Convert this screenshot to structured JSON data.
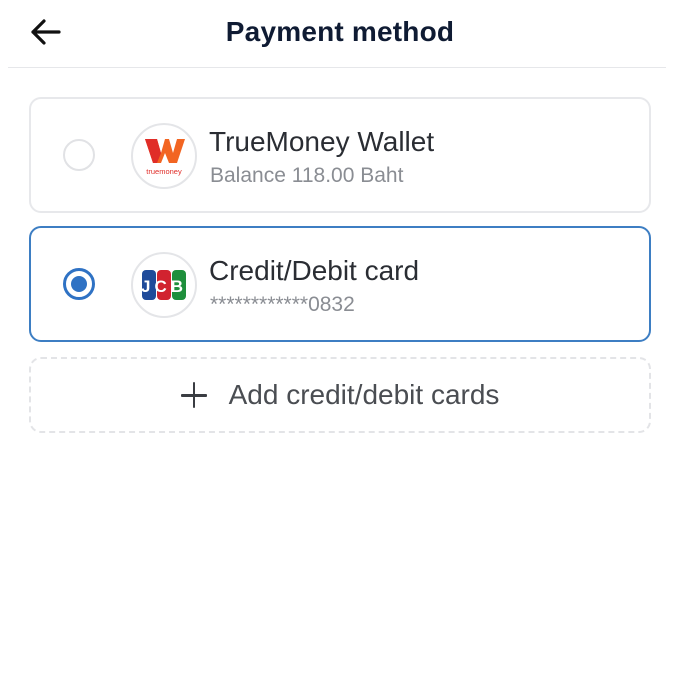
{
  "header": {
    "title": "Payment method",
    "back_icon": "arrow-left-icon"
  },
  "options": [
    {
      "name": "TrueMoney Wallet",
      "subtitle": "Balance 118.00 Baht",
      "logo_icon": "truemoney-logo-icon",
      "logo_text": "truemoney",
      "selected": false
    },
    {
      "name": "Credit/Debit card",
      "subtitle": "************0832",
      "logo_icon": "jcb-logo-icon",
      "logo_text": "JCB",
      "selected": true
    }
  ],
  "add_card": {
    "label": "Add credit/debit cards",
    "icon": "plus-icon"
  },
  "colors": {
    "accent": "#2f72c4",
    "title": "#0f1b33",
    "truemoney_orange": "#f26522",
    "truemoney_red": "#e02d28",
    "jcb_blue": "#1f4b9a",
    "jcb_red": "#d1232f",
    "jcb_green": "#1e8f3c"
  }
}
